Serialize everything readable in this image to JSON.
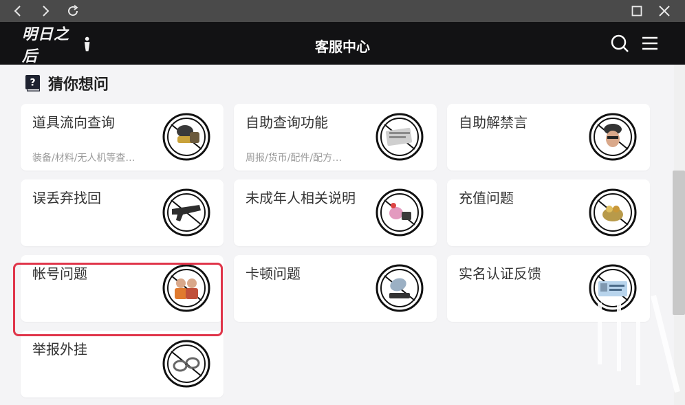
{
  "window": {
    "back_icon": "chevron-left-icon",
    "forward_icon": "chevron-right-icon",
    "reload_icon": "reload-icon",
    "maximize_icon": "maximize-icon",
    "close_icon": "close-icon"
  },
  "header": {
    "logo_text": "明日之后",
    "title": "客服中心",
    "search_icon": "search-icon",
    "menu_icon": "menu-icon"
  },
  "section": {
    "title": "猜你想问",
    "icon": "question-book-icon"
  },
  "cards": [
    {
      "title": "道具流向查询",
      "subtitle": "装备/材料/无人机等查…",
      "icon": "helmet-gear-icon"
    },
    {
      "title": "自助查询功能",
      "subtitle": "周报/货币/配件/配方…",
      "icon": "documents-icon"
    },
    {
      "title": "自助解禁言",
      "subtitle": "",
      "icon": "masked-face-icon"
    },
    {
      "title": "误丢弃找回",
      "subtitle": "",
      "icon": "gun-icon"
    },
    {
      "title": "未成年人相关说明",
      "subtitle": "",
      "icon": "toy-gift-icon"
    },
    {
      "title": "充值问题",
      "subtitle": "",
      "icon": "treasure-icon"
    },
    {
      "title": "帐号问题",
      "subtitle": "",
      "icon": "characters-icon"
    },
    {
      "title": "卡顿问题",
      "subtitle": "",
      "icon": "satellite-dish-icon"
    },
    {
      "title": "实名认证反馈",
      "subtitle": "",
      "icon": "id-card-icon"
    },
    {
      "title": "举报外挂",
      "subtitle": "",
      "icon": "handcuffs-icon"
    }
  ],
  "colors": {
    "header_bg": "#121214",
    "titlebar_bg": "#4a4a4a",
    "page_bg": "#f4f4f6",
    "highlight": "#e0354a"
  }
}
